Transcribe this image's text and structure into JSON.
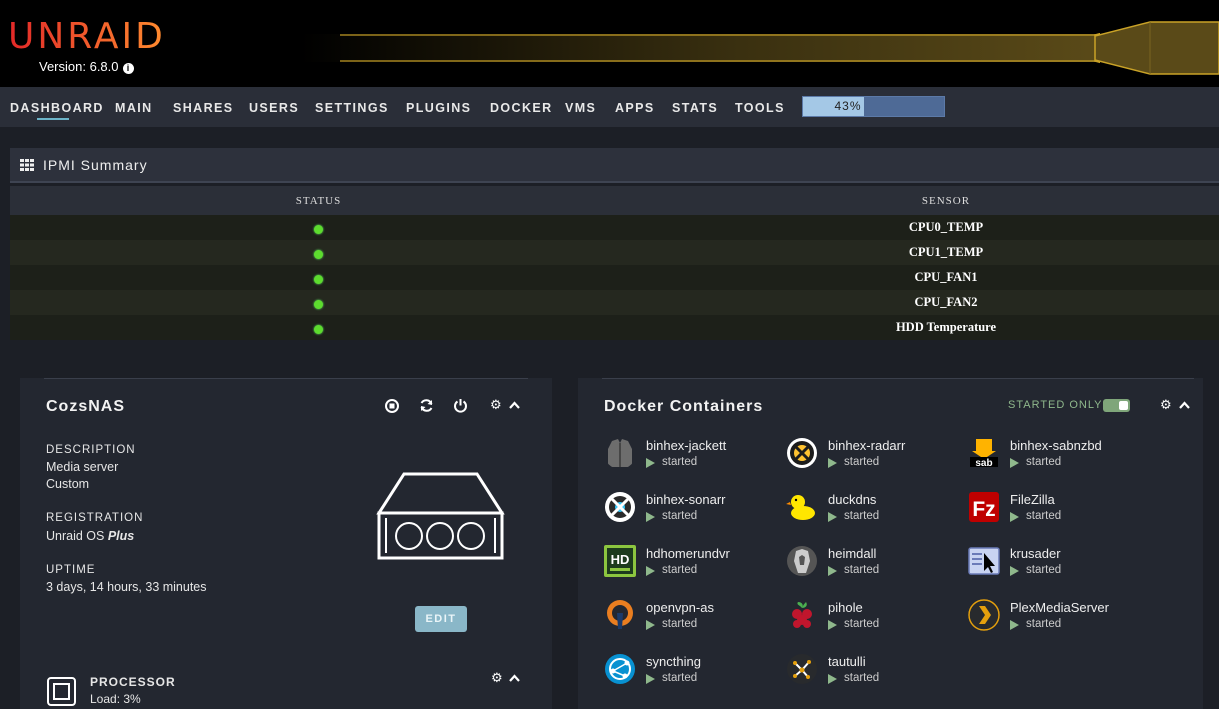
{
  "header": {
    "logo": "UNRAID",
    "version": "Version: 6.8.0"
  },
  "nav": {
    "items": [
      "DASHBOARD",
      "MAIN",
      "SHARES",
      "USERS",
      "SETTINGS",
      "PLUGINS",
      "DOCKER",
      "VMS",
      "APPS",
      "STATS",
      "TOOLS"
    ],
    "progress_text": "43%",
    "progress_fraction": 0.43
  },
  "ipmi": {
    "title": "IPMI Summary",
    "headers": [
      "STATUS",
      "SENSOR"
    ],
    "rows": [
      "CPU0_TEMP",
      "CPU1_TEMP",
      "CPU_FAN1",
      "CPU_FAN2",
      "HDD Temperature"
    ],
    "status_color": "#5ddc2e"
  },
  "server": {
    "name": "CozsNAS",
    "description_label": "DESCRIPTION",
    "description_1": "Media server",
    "description_2": "Custom",
    "registration_label": "REGISTRATION",
    "registration_prefix": "Unraid OS ",
    "registration_plan": "Plus",
    "uptime_label": "UPTIME",
    "uptime": "3 days, 14 hours, 33 minutes",
    "edit_label": "EDIT",
    "processor_label": "PROCESSOR",
    "processor_load": "Load: 3%"
  },
  "docker": {
    "title": "Docker Containers",
    "filter_label": "STARTED ONLY",
    "containers": [
      {
        "name": "binhex-jackett",
        "state": "started"
      },
      {
        "name": "binhex-radarr",
        "state": "started"
      },
      {
        "name": "binhex-sabnzbd",
        "state": "started"
      },
      {
        "name": "binhex-sonarr",
        "state": "started"
      },
      {
        "name": "duckdns",
        "state": "started"
      },
      {
        "name": "FileZilla",
        "state": "started"
      },
      {
        "name": "hdhomerundvr",
        "state": "started"
      },
      {
        "name": "heimdall",
        "state": "started"
      },
      {
        "name": "krusader",
        "state": "started"
      },
      {
        "name": "openvpn-as",
        "state": "started"
      },
      {
        "name": "pihole",
        "state": "started"
      },
      {
        "name": "PlexMediaServer",
        "state": "started"
      },
      {
        "name": "syncthing",
        "state": "started"
      },
      {
        "name": "tautulli",
        "state": "started"
      }
    ]
  },
  "colors": {
    "accent": "#f15a2c",
    "nav_underline": "#6cb4c8",
    "started_play": "#8fb88c"
  }
}
